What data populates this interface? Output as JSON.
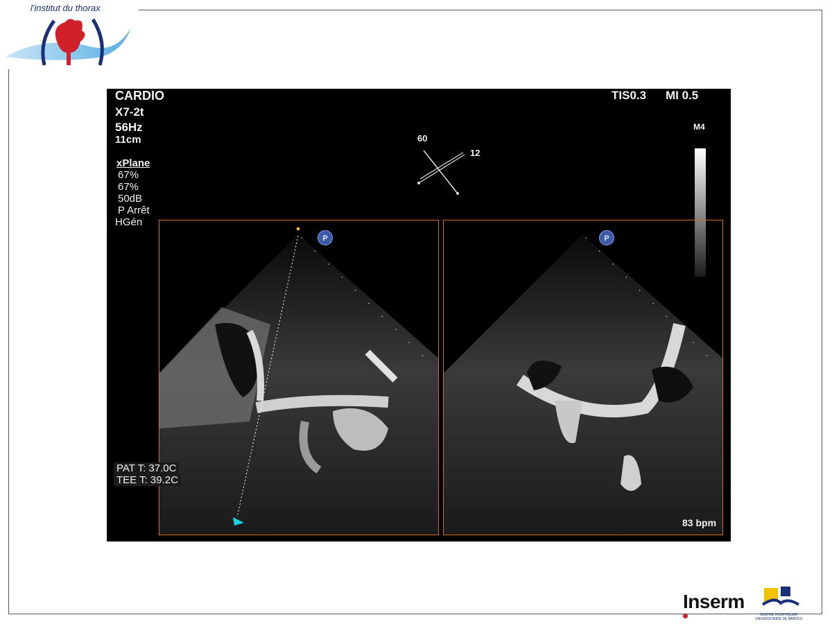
{
  "header": {
    "logo_text": "l'institut du thorax"
  },
  "ultrasound": {
    "mode": "CARDIO",
    "probe": "X7-2t",
    "frame_rate": "56Hz",
    "depth": "11cm",
    "tis": "TIS0.3",
    "mi": "MI 0.5",
    "map": "M4",
    "settings_title": "xPlane",
    "settings": [
      "67%",
      "67%",
      "50dB",
      "P Arrêt",
      "HGén"
    ],
    "angle_primary": "60",
    "angle_secondary": "12",
    "pat_temp": "PAT T: 37.0C",
    "tee_temp": "TEE T: 39.2C",
    "heart_rate": "83 bpm",
    "marker_label": "P"
  },
  "footer": {
    "inserm_label": "Inserm",
    "chu_label": "CENTRE HOSPITALIER UNIVERSITAIRE DE NANTES"
  },
  "colors": {
    "frame_orange": "#d66a1f",
    "logo_blue": "#1a2f7a",
    "logo_red": "#d0202a"
  }
}
